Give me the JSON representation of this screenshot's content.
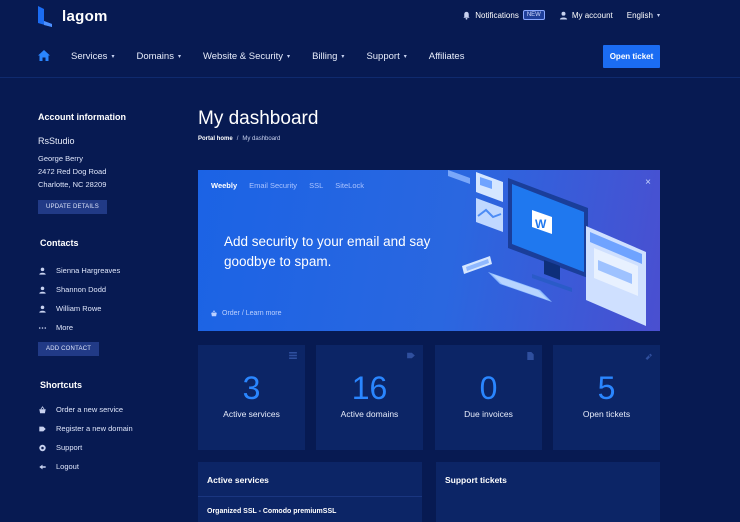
{
  "brand": {
    "name": "lagom",
    "accent": "#1b6cf2",
    "background": "#071a52"
  },
  "topbar": {
    "notifications": "Notifications",
    "notifications_badge": "NEW",
    "account": "My account",
    "language": "English"
  },
  "nav": {
    "items": [
      {
        "label": "Services",
        "dropdown": true
      },
      {
        "label": "Domains",
        "dropdown": true
      },
      {
        "label": "Website & Security",
        "dropdown": true
      },
      {
        "label": "Billing",
        "dropdown": true
      },
      {
        "label": "Support",
        "dropdown": true
      },
      {
        "label": "Affiliates",
        "dropdown": false
      }
    ],
    "open_ticket": "Open ticket"
  },
  "sidebar": {
    "account": {
      "heading": "Account information",
      "company": "RsStudio",
      "address": [
        "George Berry",
        "2472 Red Dog Road",
        "Charlotte, NC 28209"
      ],
      "button": "UPDATE DETAILS"
    },
    "contacts": {
      "heading": "Contacts",
      "items": [
        "Sienna Hargreaves",
        "Shannon Dodd",
        "William Rowe",
        "More"
      ],
      "button": "ADD CONTACT"
    },
    "shortcuts": {
      "heading": "Shortcuts",
      "items": [
        "Order a new service",
        "Register a new domain",
        "Support",
        "Logout"
      ]
    }
  },
  "main": {
    "title": "My dashboard",
    "breadcrumb": {
      "home": "Portal home",
      "sep": "/",
      "current": "My dashboard"
    }
  },
  "promo": {
    "tabs": [
      "Weebly",
      "Email Security",
      "SSL",
      "SiteLock"
    ],
    "active_tab": "Weebly",
    "headline": "Add security to your email and say goodbye to spam.",
    "link": "Order / Learn more",
    "close": "×"
  },
  "stats": [
    {
      "value": "3",
      "label": "Active services",
      "icon": "list-icon"
    },
    {
      "value": "16",
      "label": "Active domains",
      "icon": "tag-icon"
    },
    {
      "value": "0",
      "label": "Due invoices",
      "icon": "document-icon"
    },
    {
      "value": "5",
      "label": "Open tickets",
      "icon": "ticket-icon"
    }
  ],
  "panels": {
    "active_services": {
      "title": "Active services",
      "first_row": "Organized SSL - Comodo premiumSSL"
    },
    "support_tickets": {
      "title": "Support tickets"
    }
  }
}
